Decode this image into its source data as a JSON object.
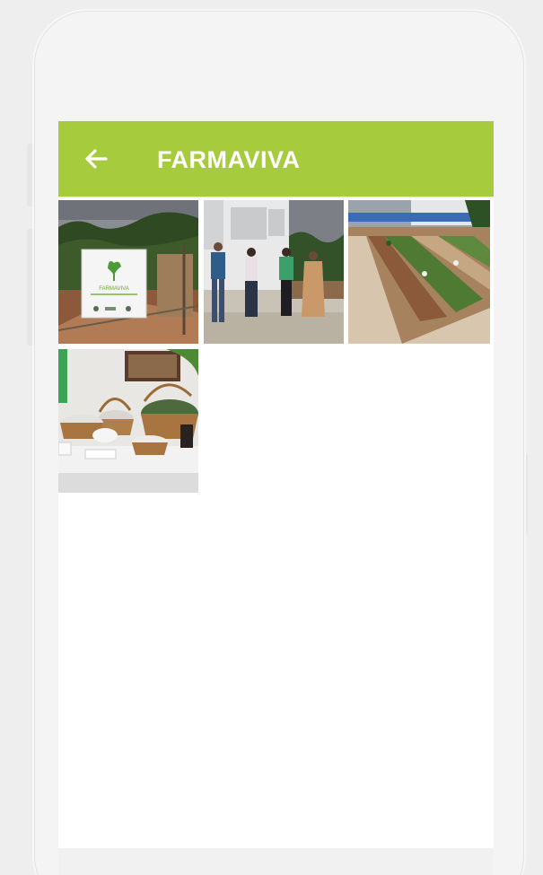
{
  "appbar": {
    "title": "FARMAVIVA",
    "back_icon": "arrow-left-icon",
    "background_color": "#a6cb3c",
    "text_color": "#ffffff"
  },
  "gallery": {
    "photos": [
      {
        "name": "sign-photo",
        "sign_text": "FARMAVIVA"
      },
      {
        "name": "group-photo"
      },
      {
        "name": "garden-beds-photo"
      },
      {
        "name": "baskets-table-photo"
      }
    ]
  }
}
